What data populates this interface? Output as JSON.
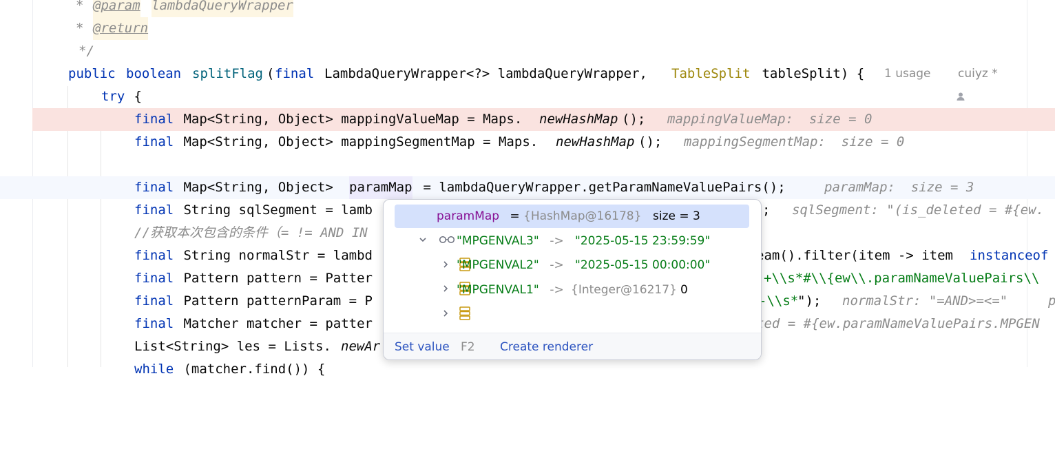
{
  "code": {
    "doc_star_1": "* ",
    "doc_param_tag": "@param",
    "doc_param_name": "lambdaQueryWrapper",
    "doc_star_2": "* ",
    "doc_return_tag": "@return",
    "doc_end": "*/",
    "l4_public": "public",
    "l4_boolean": "boolean",
    "l4_method": "splitFlag",
    "l4_open": "(",
    "l4_final": "final",
    "l4_type": "LambdaQueryWrapper<?> lambdaQueryWrapper, ",
    "l4_tscls": "TableSplit",
    "l4_rest": " tableSplit) {",
    "l4_usage": "1 usage",
    "l4_author": "cuiyz *",
    "l5_try": "try",
    "l5_brace": " {",
    "l6_final": "final",
    "l6_code": " Map<String, Object> mappingValueMap = Maps.",
    "l6_call": "newHashMap",
    "l6_end": "();",
    "l6_hint": "mappingValueMap:  size = 0",
    "l7_final": "final",
    "l7_code": " Map<String, Object> mappingSegmentMap = Maps.",
    "l7_call": "newHashMap",
    "l7_end": "();",
    "l7_hint": "mappingSegmentMap:  size = 0",
    "l9_final": "final",
    "l9_code1": " Map<String, Object> ",
    "l9_var": "paramMap",
    "l9_code2": " = lambdaQueryWrapper.getParamNameValuePairs();",
    "l9_hint": "paramMap:  size = 3",
    "l10_final": "final",
    "l10_code": " String sqlSegment = lamb",
    "l10_tail": ";",
    "l10_hint": "sqlSegment: \"(is_deleted = #{ew.",
    "l11_comment": "//获取本次包含的条件（= != AND IN",
    "l12_final": "final",
    "l12_code": " String normalStr = lambd",
    "l12_tail1": "eam().filter(item -> item ",
    "l12_tail_kw": "instanceof",
    "l13_final": "final",
    "l13_code": " Pattern pattern = Patter",
    "l13_tail_str": "+\\\\s*#\\\\{ew\\\\.paramNameValuePairs\\\\",
    "l14_final": "final",
    "l14_code": " Pattern patternParam = P",
    "l14_tail_str": "-\\\\s*",
    "l14_tail_end": "\");",
    "l14_hint": "normalStr: \"=AND>=<=\"",
    "l14_hint2": "p",
    "l15_final": "final",
    "l15_code": " Matcher matcher = patter",
    "l15_hint": "ted = #{ew.paramNameValuePairs.MPGEN",
    "l16_code": "List<String> les = Lists.",
    "l16_call": "newAr",
    "l17_kw": "while",
    "l17_code": " (matcher.find()) {"
  },
  "popup": {
    "root": {
      "name": "paramMap",
      "eq": " = ",
      "ref": "{HashMap@16178}",
      "size": "size = 3"
    },
    "entries": [
      {
        "key": "\"MPGENVAL3\"",
        "arrow": " -> ",
        "value": "\"2025-05-15 23:59:59\"",
        "ref": ""
      },
      {
        "key": "\"MPGENVAL2\"",
        "arrow": " -> ",
        "value": "\"2025-05-15 00:00:00\"",
        "ref": ""
      },
      {
        "key": "\"MPGENVAL1\"",
        "arrow": " -> ",
        "value": "0",
        "ref": "{Integer@16217}"
      }
    ],
    "set_value": "Set value",
    "set_value_key": "F2",
    "create_renderer": "Create renderer"
  },
  "icons": {
    "expand": "chevron-down-icon",
    "collapse": "chevron-right-icon",
    "watch": "glasses-icon",
    "field": "map-entry-icon",
    "user": "user-icon"
  }
}
